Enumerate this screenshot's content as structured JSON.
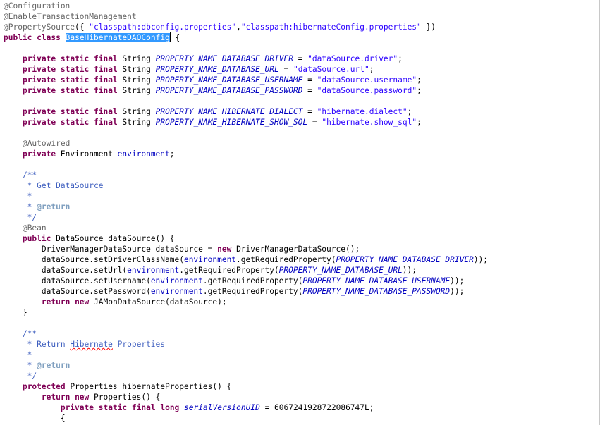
{
  "editor": {
    "lines": [
      [
        {
          "t": "@Configuration",
          "c": "ann"
        }
      ],
      [
        {
          "t": "@EnableTransactionManagement",
          "c": "ann"
        }
      ],
      [
        {
          "t": "@PropertySource",
          "c": "ann"
        },
        {
          "t": "({ ",
          "c": "plain"
        },
        {
          "t": "\"classpath:dbconfig.properties\"",
          "c": "str"
        },
        {
          "t": ",",
          "c": "plain"
        },
        {
          "t": "\"classpath:hibernateConfig.properties\"",
          "c": "str"
        },
        {
          "t": " })",
          "c": "plain"
        }
      ],
      [
        {
          "t": "public",
          "c": "kw"
        },
        {
          "t": " ",
          "c": "plain"
        },
        {
          "t": "class",
          "c": "kw"
        },
        {
          "t": " ",
          "c": "plain"
        },
        {
          "t": "BaseHibernateDAOConfig",
          "c": "sel"
        },
        {
          "t": "|",
          "c": "caret"
        },
        {
          "t": " {",
          "c": "plain"
        }
      ],
      [],
      [
        {
          "t": "    ",
          "c": "plain"
        },
        {
          "t": "private",
          "c": "kw"
        },
        {
          "t": " ",
          "c": "plain"
        },
        {
          "t": "static",
          "c": "kw"
        },
        {
          "t": " ",
          "c": "plain"
        },
        {
          "t": "final",
          "c": "kw"
        },
        {
          "t": " String ",
          "c": "plain"
        },
        {
          "t": "PROPERTY_NAME_DATABASE_DRIVER",
          "c": "fld"
        },
        {
          "t": " = ",
          "c": "plain"
        },
        {
          "t": "\"dataSource.driver\"",
          "c": "str"
        },
        {
          "t": ";",
          "c": "plain"
        }
      ],
      [
        {
          "t": "    ",
          "c": "plain"
        },
        {
          "t": "private",
          "c": "kw"
        },
        {
          "t": " ",
          "c": "plain"
        },
        {
          "t": "static",
          "c": "kw"
        },
        {
          "t": " ",
          "c": "plain"
        },
        {
          "t": "final",
          "c": "kw"
        },
        {
          "t": " String ",
          "c": "plain"
        },
        {
          "t": "PROPERTY_NAME_DATABASE_URL",
          "c": "fld"
        },
        {
          "t": " = ",
          "c": "plain"
        },
        {
          "t": "\"dataSource.url\"",
          "c": "str"
        },
        {
          "t": ";",
          "c": "plain"
        }
      ],
      [
        {
          "t": "    ",
          "c": "plain"
        },
        {
          "t": "private",
          "c": "kw"
        },
        {
          "t": " ",
          "c": "plain"
        },
        {
          "t": "static",
          "c": "kw"
        },
        {
          "t": " ",
          "c": "plain"
        },
        {
          "t": "final",
          "c": "kw"
        },
        {
          "t": " String ",
          "c": "plain"
        },
        {
          "t": "PROPERTY_NAME_DATABASE_USERNAME",
          "c": "fld"
        },
        {
          "t": " = ",
          "c": "plain"
        },
        {
          "t": "\"dataSource.username\"",
          "c": "str"
        },
        {
          "t": ";",
          "c": "plain"
        }
      ],
      [
        {
          "t": "    ",
          "c": "plain"
        },
        {
          "t": "private",
          "c": "kw"
        },
        {
          "t": " ",
          "c": "plain"
        },
        {
          "t": "static",
          "c": "kw"
        },
        {
          "t": " ",
          "c": "plain"
        },
        {
          "t": "final",
          "c": "kw"
        },
        {
          "t": " String ",
          "c": "plain"
        },
        {
          "t": "PROPERTY_NAME_DATABASE_PASSWORD",
          "c": "fld"
        },
        {
          "t": " = ",
          "c": "plain"
        },
        {
          "t": "\"dataSource.password\"",
          "c": "str"
        },
        {
          "t": ";",
          "c": "plain"
        }
      ],
      [],
      [
        {
          "t": "    ",
          "c": "plain"
        },
        {
          "t": "private",
          "c": "kw"
        },
        {
          "t": " ",
          "c": "plain"
        },
        {
          "t": "static",
          "c": "kw"
        },
        {
          "t": " ",
          "c": "plain"
        },
        {
          "t": "final",
          "c": "kw"
        },
        {
          "t": " String ",
          "c": "plain"
        },
        {
          "t": "PROPERTY_NAME_HIBERNATE_DIALECT",
          "c": "fld"
        },
        {
          "t": " = ",
          "c": "plain"
        },
        {
          "t": "\"hibernate.dialect\"",
          "c": "str"
        },
        {
          "t": ";",
          "c": "plain"
        }
      ],
      [
        {
          "t": "    ",
          "c": "plain"
        },
        {
          "t": "private",
          "c": "kw"
        },
        {
          "t": " ",
          "c": "plain"
        },
        {
          "t": "static",
          "c": "kw"
        },
        {
          "t": " ",
          "c": "plain"
        },
        {
          "t": "final",
          "c": "kw"
        },
        {
          "t": " String ",
          "c": "plain"
        },
        {
          "t": "PROPERTY_NAME_HIBERNATE_SHOW_SQL",
          "c": "fld"
        },
        {
          "t": " = ",
          "c": "plain"
        },
        {
          "t": "\"hibernate.show_sql\"",
          "c": "str"
        },
        {
          "t": ";",
          "c": "plain"
        }
      ],
      [],
      [
        {
          "t": "    ",
          "c": "plain"
        },
        {
          "t": "@Autowired",
          "c": "ann"
        }
      ],
      [
        {
          "t": "    ",
          "c": "plain"
        },
        {
          "t": "private",
          "c": "kw"
        },
        {
          "t": " Environment ",
          "c": "plain"
        },
        {
          "t": "environment",
          "c": "var"
        },
        {
          "t": ";",
          "c": "plain"
        }
      ],
      [],
      [
        {
          "t": "    ",
          "c": "plain"
        },
        {
          "t": "/**",
          "c": "doc"
        }
      ],
      [
        {
          "t": "     * Get DataSource",
          "c": "doc"
        }
      ],
      [
        {
          "t": "     *",
          "c": "doc"
        }
      ],
      [
        {
          "t": "     * ",
          "c": "doc"
        },
        {
          "t": "@return",
          "c": "tag"
        }
      ],
      [
        {
          "t": "     */",
          "c": "doc"
        }
      ],
      [
        {
          "t": "    ",
          "c": "plain"
        },
        {
          "t": "@Bean",
          "c": "ann"
        }
      ],
      [
        {
          "t": "    ",
          "c": "plain"
        },
        {
          "t": "public",
          "c": "kw"
        },
        {
          "t": " DataSource dataSource() {",
          "c": "plain"
        }
      ],
      [
        {
          "t": "        DriverManagerDataSource dataSource = ",
          "c": "plain"
        },
        {
          "t": "new",
          "c": "kw"
        },
        {
          "t": " DriverManagerDataSource();",
          "c": "plain"
        }
      ],
      [
        {
          "t": "        dataSource.setDriverClassName(",
          "c": "plain"
        },
        {
          "t": "environment",
          "c": "var"
        },
        {
          "t": ".getRequiredProperty(",
          "c": "plain"
        },
        {
          "t": "PROPERTY_NAME_DATABASE_DRIVER",
          "c": "fld"
        },
        {
          "t": "));",
          "c": "plain"
        }
      ],
      [
        {
          "t": "        dataSource.setUrl(",
          "c": "plain"
        },
        {
          "t": "environment",
          "c": "var"
        },
        {
          "t": ".getRequiredProperty(",
          "c": "plain"
        },
        {
          "t": "PROPERTY_NAME_DATABASE_URL",
          "c": "fld"
        },
        {
          "t": "));",
          "c": "plain"
        }
      ],
      [
        {
          "t": "        dataSource.setUsername(",
          "c": "plain"
        },
        {
          "t": "environment",
          "c": "var"
        },
        {
          "t": ".getRequiredProperty(",
          "c": "plain"
        },
        {
          "t": "PROPERTY_NAME_DATABASE_USERNAME",
          "c": "fld"
        },
        {
          "t": "));",
          "c": "plain"
        }
      ],
      [
        {
          "t": "        dataSource.setPassword(",
          "c": "plain"
        },
        {
          "t": "environment",
          "c": "var"
        },
        {
          "t": ".getRequiredProperty(",
          "c": "plain"
        },
        {
          "t": "PROPERTY_NAME_DATABASE_PASSWORD",
          "c": "fld"
        },
        {
          "t": "));",
          "c": "plain"
        }
      ],
      [
        {
          "t": "        ",
          "c": "plain"
        },
        {
          "t": "return",
          "c": "kw"
        },
        {
          "t": " ",
          "c": "plain"
        },
        {
          "t": "new",
          "c": "kw"
        },
        {
          "t": " JAMonDataSource(dataSource);",
          "c": "plain"
        }
      ],
      [
        {
          "t": "    }",
          "c": "plain"
        }
      ],
      [],
      [
        {
          "t": "    ",
          "c": "plain"
        },
        {
          "t": "/**",
          "c": "doc"
        }
      ],
      [
        {
          "t": "     * Return ",
          "c": "doc"
        },
        {
          "t": "Hibernate",
          "c": "docspell"
        },
        {
          "t": " Properties",
          "c": "doc"
        }
      ],
      [
        {
          "t": "     *",
          "c": "doc"
        }
      ],
      [
        {
          "t": "     * ",
          "c": "doc"
        },
        {
          "t": "@return",
          "c": "tag"
        }
      ],
      [
        {
          "t": "     */",
          "c": "doc"
        }
      ],
      [
        {
          "t": "    ",
          "c": "plain"
        },
        {
          "t": "protected",
          "c": "kw"
        },
        {
          "t": " Properties hibernateProperties() {",
          "c": "plain"
        }
      ],
      [
        {
          "t": "        ",
          "c": "plain"
        },
        {
          "t": "return",
          "c": "kw"
        },
        {
          "t": " ",
          "c": "plain"
        },
        {
          "t": "new",
          "c": "kw"
        },
        {
          "t": " Properties() {",
          "c": "plain"
        }
      ],
      [
        {
          "t": "            ",
          "c": "plain"
        },
        {
          "t": "private",
          "c": "kw"
        },
        {
          "t": " ",
          "c": "plain"
        },
        {
          "t": "static",
          "c": "kw"
        },
        {
          "t": " ",
          "c": "plain"
        },
        {
          "t": "final",
          "c": "kw"
        },
        {
          "t": " ",
          "c": "plain"
        },
        {
          "t": "long",
          "c": "kw"
        },
        {
          "t": " ",
          "c": "plain"
        },
        {
          "t": "serialVersionUID",
          "c": "fld"
        },
        {
          "t": " = 6067241928722086747L;",
          "c": "plain"
        }
      ],
      [
        {
          "t": "            {",
          "c": "plain"
        }
      ]
    ]
  }
}
